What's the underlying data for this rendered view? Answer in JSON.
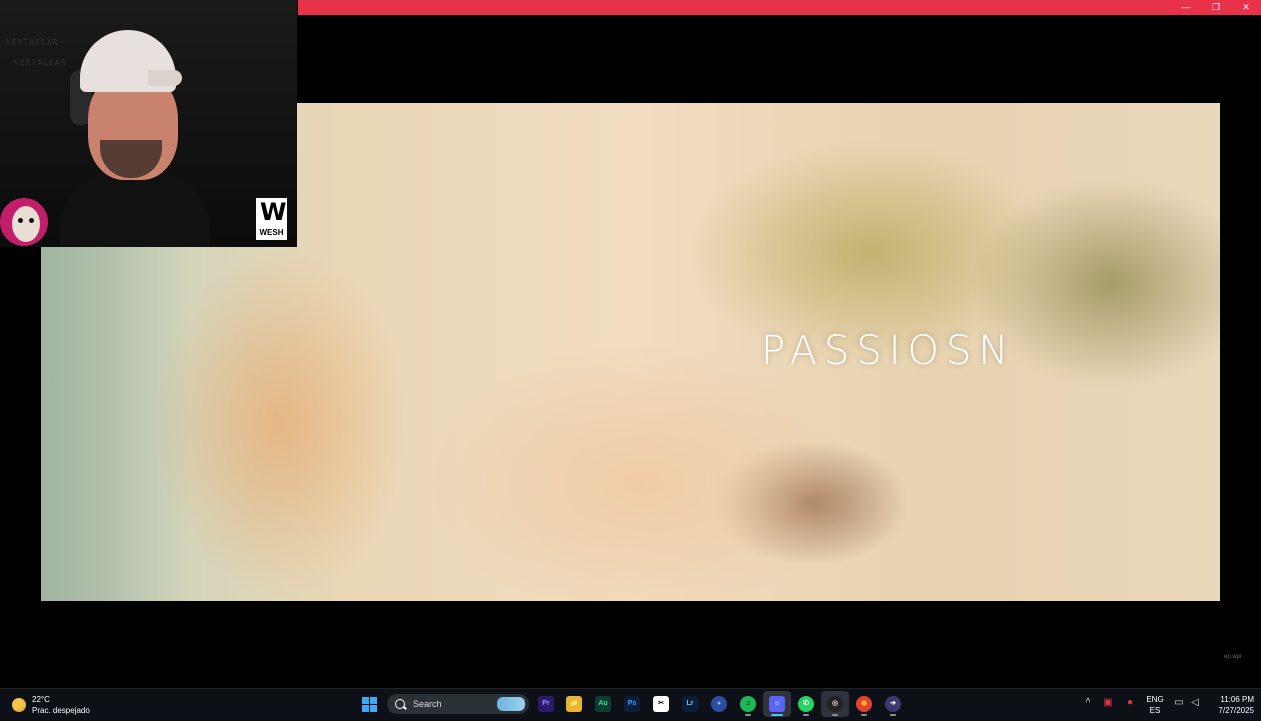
{
  "window": {
    "controls": {
      "minimize": "—",
      "maximize": "❐",
      "close": "✕"
    },
    "accent_color": "#e8324a"
  },
  "video": {
    "title_text": "PASSIOSN",
    "corner_mark": "ep.wpr"
  },
  "webcam_overlay": {
    "bg_text_1": "VERTAGEAR",
    "bg_text_2": "VERTAGEAR",
    "logo_letter": "W",
    "logo_text": "WESH"
  },
  "taskbar": {
    "weather": {
      "temperature": "22°C",
      "condition": "Prac. despejado"
    },
    "search": {
      "label": "Search"
    },
    "apps": [
      {
        "name": "premiere-pro",
        "glyph": "Pr",
        "color": "#2a1a6b",
        "fg": "#9b8cff"
      },
      {
        "name": "file-explorer",
        "glyph": "📁",
        "color": "#e8b431",
        "fg": "#5a3e00"
      },
      {
        "name": "audition",
        "glyph": "Au",
        "color": "#0e3d2f",
        "fg": "#32e0a0"
      },
      {
        "name": "photoshop",
        "glyph": "Ps",
        "color": "#0a1e3a",
        "fg": "#31a8ff"
      },
      {
        "name": "capcut",
        "glyph": "✂",
        "color": "#ffffff",
        "fg": "#000000"
      },
      {
        "name": "lightroom",
        "glyph": "Lr",
        "color": "#0a1e3a",
        "fg": "#7fb8ff"
      },
      {
        "name": "orb-app",
        "glyph": "●",
        "color": "#2b4f9e",
        "fg": "#8fb0ff"
      },
      {
        "name": "spotify",
        "glyph": "♫",
        "color": "#1db954",
        "fg": "#000000"
      },
      {
        "name": "discord",
        "glyph": "☺",
        "color": "#5865f2",
        "fg": "#ffffff"
      },
      {
        "name": "whatsapp",
        "glyph": "✆",
        "color": "#25d366",
        "fg": "#ffffff"
      },
      {
        "name": "obs",
        "glyph": "◎",
        "color": "#222222",
        "fg": "#dddddd"
      },
      {
        "name": "chrome",
        "glyph": "◉",
        "color": "#e34133",
        "fg": "#f4c20d"
      },
      {
        "name": "arrow-app",
        "glyph": "➔",
        "color": "#3a3a6e",
        "fg": "#ffffff"
      }
    ],
    "tray": {
      "chevron": "^",
      "language": {
        "line1": "ENG",
        "line2": "ES"
      },
      "time": "11:06 PM",
      "date": "7/27/2025"
    }
  }
}
